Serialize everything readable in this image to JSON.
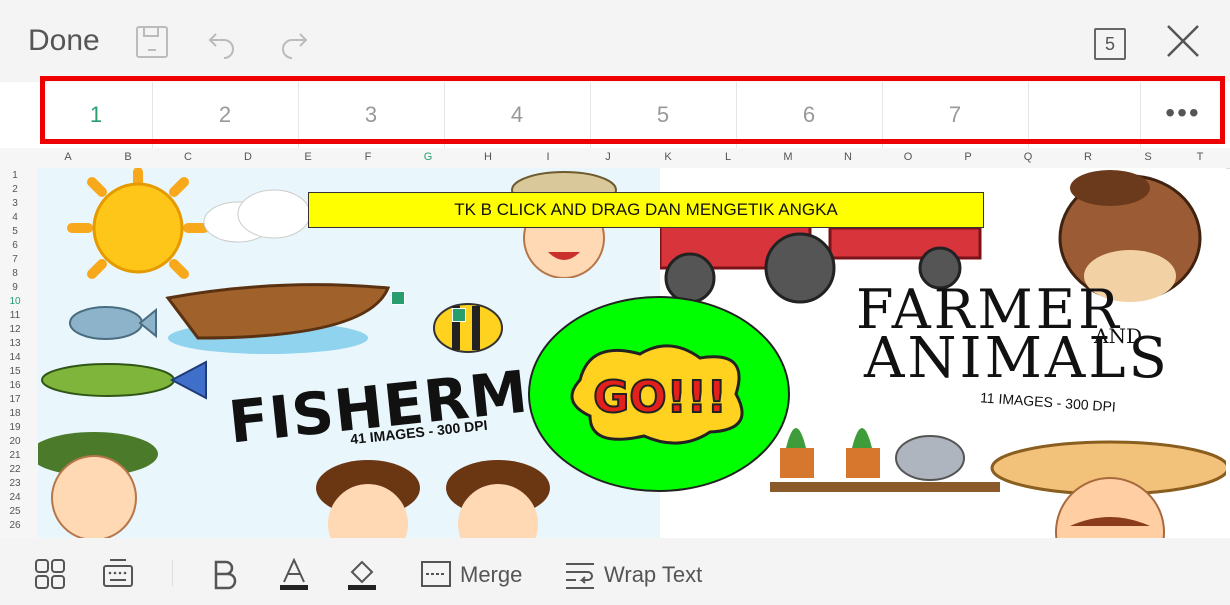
{
  "toolbar": {
    "done_label": "Done",
    "sheet_count": "5"
  },
  "number_tabs": [
    "1",
    "2",
    "3",
    "4",
    "5",
    "6",
    "7",
    ""
  ],
  "more_label": "•••",
  "columns": [
    "A",
    "B",
    "C",
    "D",
    "E",
    "F",
    "G",
    "H",
    "I",
    "J",
    "K",
    "L",
    "M",
    "N",
    "O",
    "P",
    "Q",
    "R",
    "S",
    "T"
  ],
  "selected_column": "G",
  "rows": [
    "1",
    "2",
    "3",
    "4",
    "5",
    "6",
    "7",
    "8",
    "9",
    "10",
    "11",
    "12",
    "13",
    "14",
    "15",
    "16",
    "17",
    "18",
    "19",
    "20",
    "21",
    "22",
    "23",
    "24",
    "25",
    "26"
  ],
  "selected_row": "10",
  "canvas": {
    "banner_text": "TK B CLICK AND DRAG DAN MENGETIK ANGKA",
    "go_text": "GO!!!",
    "fisher_title": "FISHERMAN",
    "fisher_sub": "41 IMAGES - 300 DPI",
    "farm_line1": "FARMER",
    "farm_and": "AND",
    "farm_line2": "ANIMALS",
    "farm_sub": "11 IMAGES - 300 DPI"
  },
  "bottombar": {
    "merge_label": "Merge",
    "wrap_label": "Wrap Text"
  },
  "colors": {
    "accent": "#2a9d6f",
    "highlight_border": "#ee0000",
    "banner_bg": "#ffff00",
    "go_bg": "#00ff00"
  }
}
